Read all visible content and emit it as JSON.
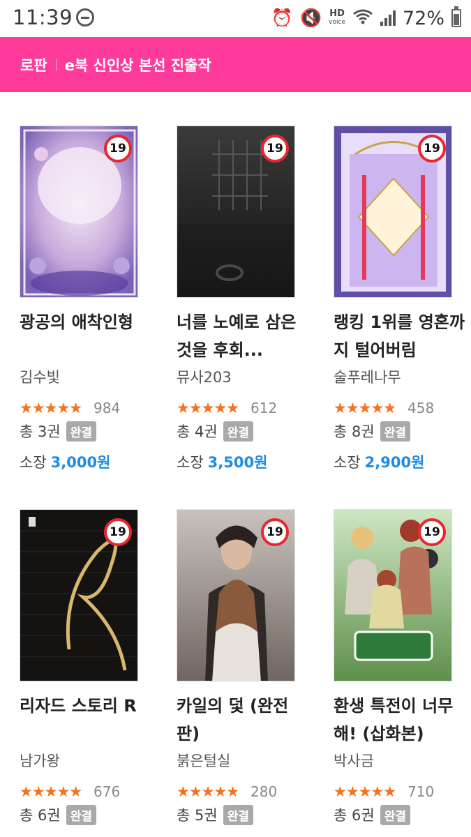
{
  "status_bar": {
    "time": "11:39",
    "hd_label": "HD",
    "hd_sub": "voice",
    "battery": "72%"
  },
  "header": {
    "category": "로판",
    "title": "e북 신인상 본선 진출작",
    "background": "#fe3a9b"
  },
  "age_label": "19",
  "books": [
    {
      "title": "광공의 애착인형",
      "author": "김수빛",
      "rating": 4.5,
      "rating_count": "984",
      "volumes": "총 3권",
      "status": "완결",
      "price_label": "소장",
      "price": "3,000원",
      "cover_theme": "lilac-ornate"
    },
    {
      "title": "너를 노예로 삼은 것을 후회...",
      "author": "뮤사203",
      "rating": 4.5,
      "rating_count": "612",
      "volumes": "총 4권",
      "status": "완결",
      "price_label": "소장",
      "price": "3,500원",
      "cover_theme": "dark-dungeon"
    },
    {
      "title": "랭킹 1위를 영혼까지 털어버림",
      "author": "술푸레나무",
      "rating": 4.8,
      "rating_count": "458",
      "volumes": "총 8권",
      "status": "완결",
      "price_label": "소장",
      "price": "2,900원",
      "cover_theme": "purple-gold"
    },
    {
      "title": "리자드 스토리 R",
      "author": "남가왕",
      "rating": 4.5,
      "rating_count": "676",
      "volumes": "총 6권",
      "status": "완결",
      "price_label": "",
      "price": "",
      "cover_theme": "black-gold-letter"
    },
    {
      "title": "카일의 덫 (완전판)",
      "author": "붉은털실",
      "rating": 4.2,
      "rating_count": "280",
      "volumes": "총 5권",
      "status": "완결",
      "price_label": "",
      "price": "",
      "cover_theme": "couple-portrait"
    },
    {
      "title": "환생 특전이 너무해! (삽화본)",
      "author": "박사금",
      "rating": 4.5,
      "rating_count": "710",
      "volumes": "총 6권",
      "status": "완결",
      "price_label": "",
      "price": "",
      "cover_theme": "group-garden"
    }
  ]
}
